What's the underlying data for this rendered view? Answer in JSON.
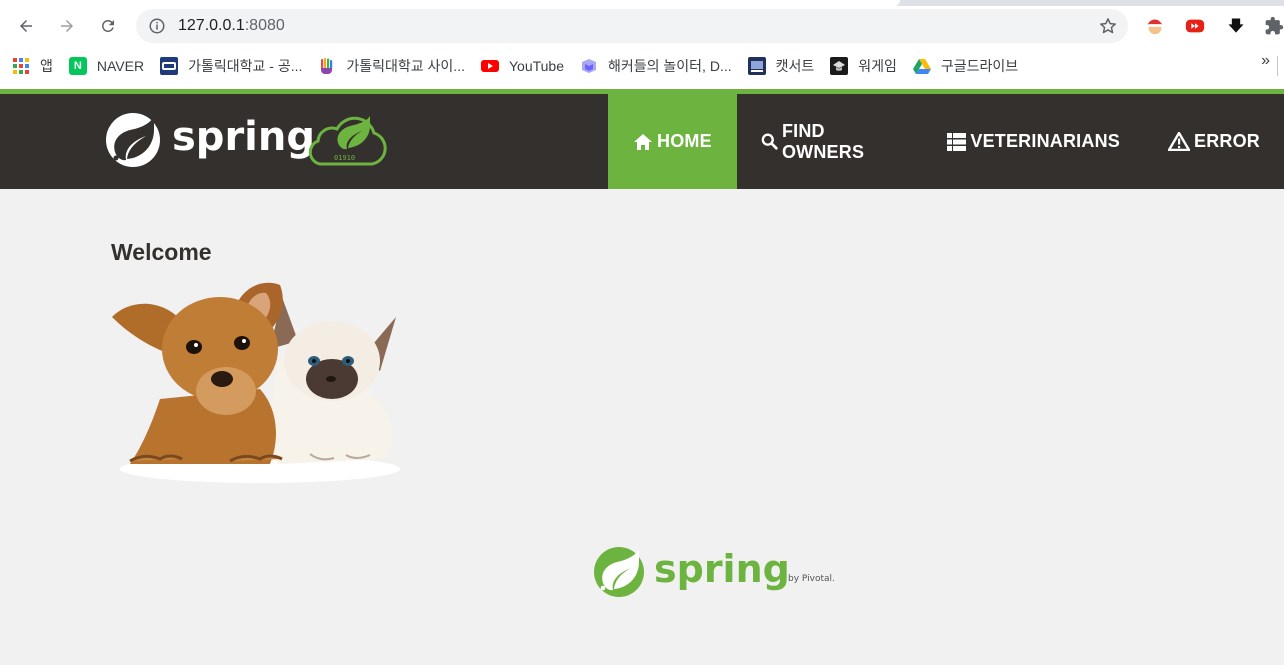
{
  "browser": {
    "url_host": "127.0.0.1",
    "url_port": ":8080",
    "bookmarks": [
      {
        "label": "앱",
        "icon": "apps-grid-icon"
      },
      {
        "label": "NAVER",
        "icon": "naver-icon"
      },
      {
        "label": "가톨릭대학교 - 공...",
        "icon": "catholic-univ-icon"
      },
      {
        "label": "가톨릭대학교 사이...",
        "icon": "hand-logo-icon"
      },
      {
        "label": "YouTube",
        "icon": "youtube-icon"
      },
      {
        "label": "해커들의 놀이터, D...",
        "icon": "dreamhack-icon"
      },
      {
        "label": "캣서트",
        "icon": "catcert-icon"
      },
      {
        "label": "워게임",
        "icon": "wargame-icon"
      },
      {
        "label": "구글드라이브",
        "icon": "google-drive-icon"
      }
    ],
    "more": "»"
  },
  "nav": {
    "brand": "spring",
    "items": [
      {
        "label": "HOME",
        "icon": "home-icon",
        "active": true
      },
      {
        "label": "FIND OWNERS",
        "icon": "search-icon",
        "active": false
      },
      {
        "label": "VETERINARIANS",
        "icon": "list-icon",
        "active": false
      },
      {
        "label": "ERROR",
        "icon": "warning-icon",
        "active": false
      }
    ]
  },
  "main": {
    "heading": "Welcome"
  },
  "footer": {
    "logo_text": "spring",
    "byline": "by Pivotal."
  },
  "colors": {
    "spring_green": "#6db33f",
    "navbar_dark": "#34302d",
    "page_bg": "#f1f1f1"
  }
}
